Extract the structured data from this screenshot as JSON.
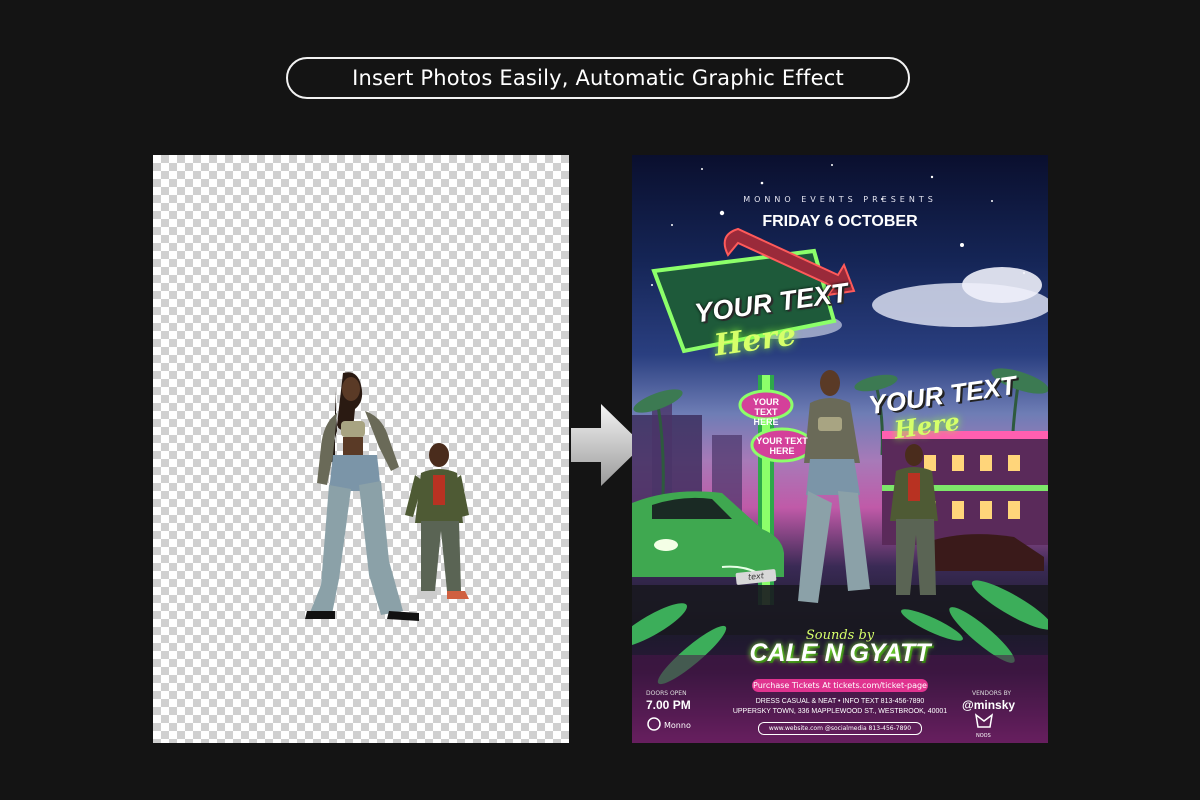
{
  "headline": "Insert Photos Easily, Automatic Graphic Effect",
  "poster": {
    "presents": "MONNO EVENTS PRESENTS",
    "date": "FRIDAY 6 OCTOBER",
    "sign_title": "YOUR TEXT",
    "sign_script": "Here",
    "oval_1": "YOUR TEXT HERE",
    "oval_2": "YOUR TEXT HERE",
    "hotel_title": "YOUR TEXT",
    "hotel_script": "Here",
    "plate": "text",
    "sounds_by": "Sounds by",
    "dj_name": "CALE N GYATT",
    "tickets": "Purchase Tickets At tickets.com/ticket-page",
    "info_line_1": "DRESS CASUAL & NEAT  •  INFO TEXT 813-456-7890",
    "info_line_2": "UPPERSKY TOWN, 336 MAPPLEWOOD ST., WESTBROOK, 40001",
    "doors_label": "DOORS OPEN",
    "doors_time": "7.00 PM",
    "vendors_label": "VENDORS BY",
    "vendors_handle": "@minsky",
    "brand": "Monno",
    "web_line": "www.website.com    @socialmedia    813-456-7890",
    "noos": "NOOS"
  },
  "colors": {
    "background": "#141414",
    "accent_pink": "#e0338f",
    "neon_green": "#d6ff6a"
  }
}
